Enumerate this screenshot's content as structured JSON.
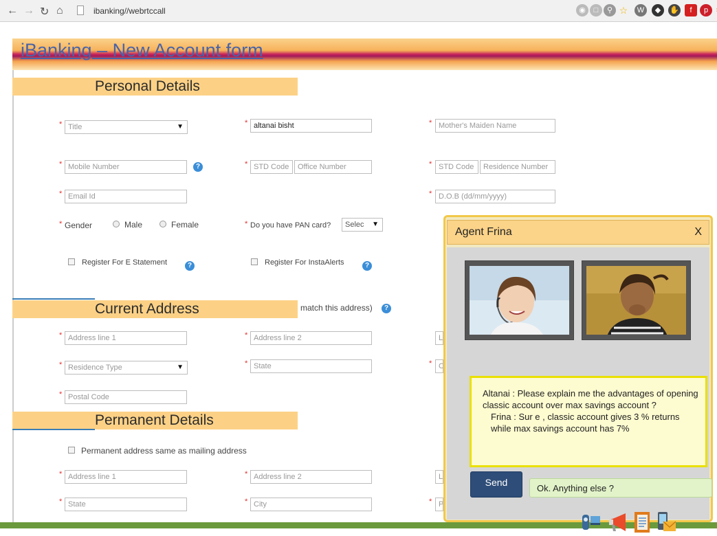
{
  "browser": {
    "url": "ibanking//webrtccall"
  },
  "page": {
    "title": "iBanking – New Account form"
  },
  "sections": {
    "personal": "Personal Details",
    "current": "Current Address",
    "permanent": "Permanent Details"
  },
  "personal": {
    "title_select": "Title",
    "name_value": "altanai bisht",
    "mothers_maiden_placeholder": "Mother's Maiden Name",
    "mobile_placeholder": "Mobile Number",
    "std_code_placeholder": "STD Code",
    "office_number_placeholder": "Office Number",
    "residence_number_placeholder": "Residence Number",
    "email_placeholder": "Email Id",
    "dob_placeholder": "D.O.B (dd/mm/yyyy)",
    "gender_label": "Gender",
    "gender_male": "Male",
    "gender_female": "Female",
    "pan_label": "Do you have PAN card?",
    "pan_select": "Selec",
    "e_statement_label": "Register For E Statement",
    "instaalerts_label": "Register For InstaAlerts"
  },
  "current": {
    "match_text": "match this address)",
    "address1_placeholder": "Address line 1",
    "address2_placeholder": "Address line 2",
    "address3_partial": "L",
    "residence_type_select": "Residence Type",
    "state_placeholder": "State",
    "country_partial": "C",
    "postal_placeholder": "Postal Code"
  },
  "permanent": {
    "same_as_mailing_label": "Permanent address same as mailing address",
    "address1_placeholder": "Address line 1",
    "address2_placeholder": "Address line 2",
    "address3_partial": "L",
    "state_placeholder": "State",
    "city_placeholder": "City",
    "pin_partial": "P"
  },
  "chat": {
    "title": "Agent Frina",
    "close": "X",
    "message_1": "Altanai : Please explain me the advantages of opening classic account over max savings account ?",
    "message_2": "Frina : Sur e , classic account gives 3 % returns while max savings account has 7%",
    "send_label": "Send",
    "input_value": "Ok. Anything else ?",
    "tools": [
      "webcam-icon",
      "megaphone-icon",
      "notebook-icon",
      "mail-phone-icon"
    ]
  }
}
